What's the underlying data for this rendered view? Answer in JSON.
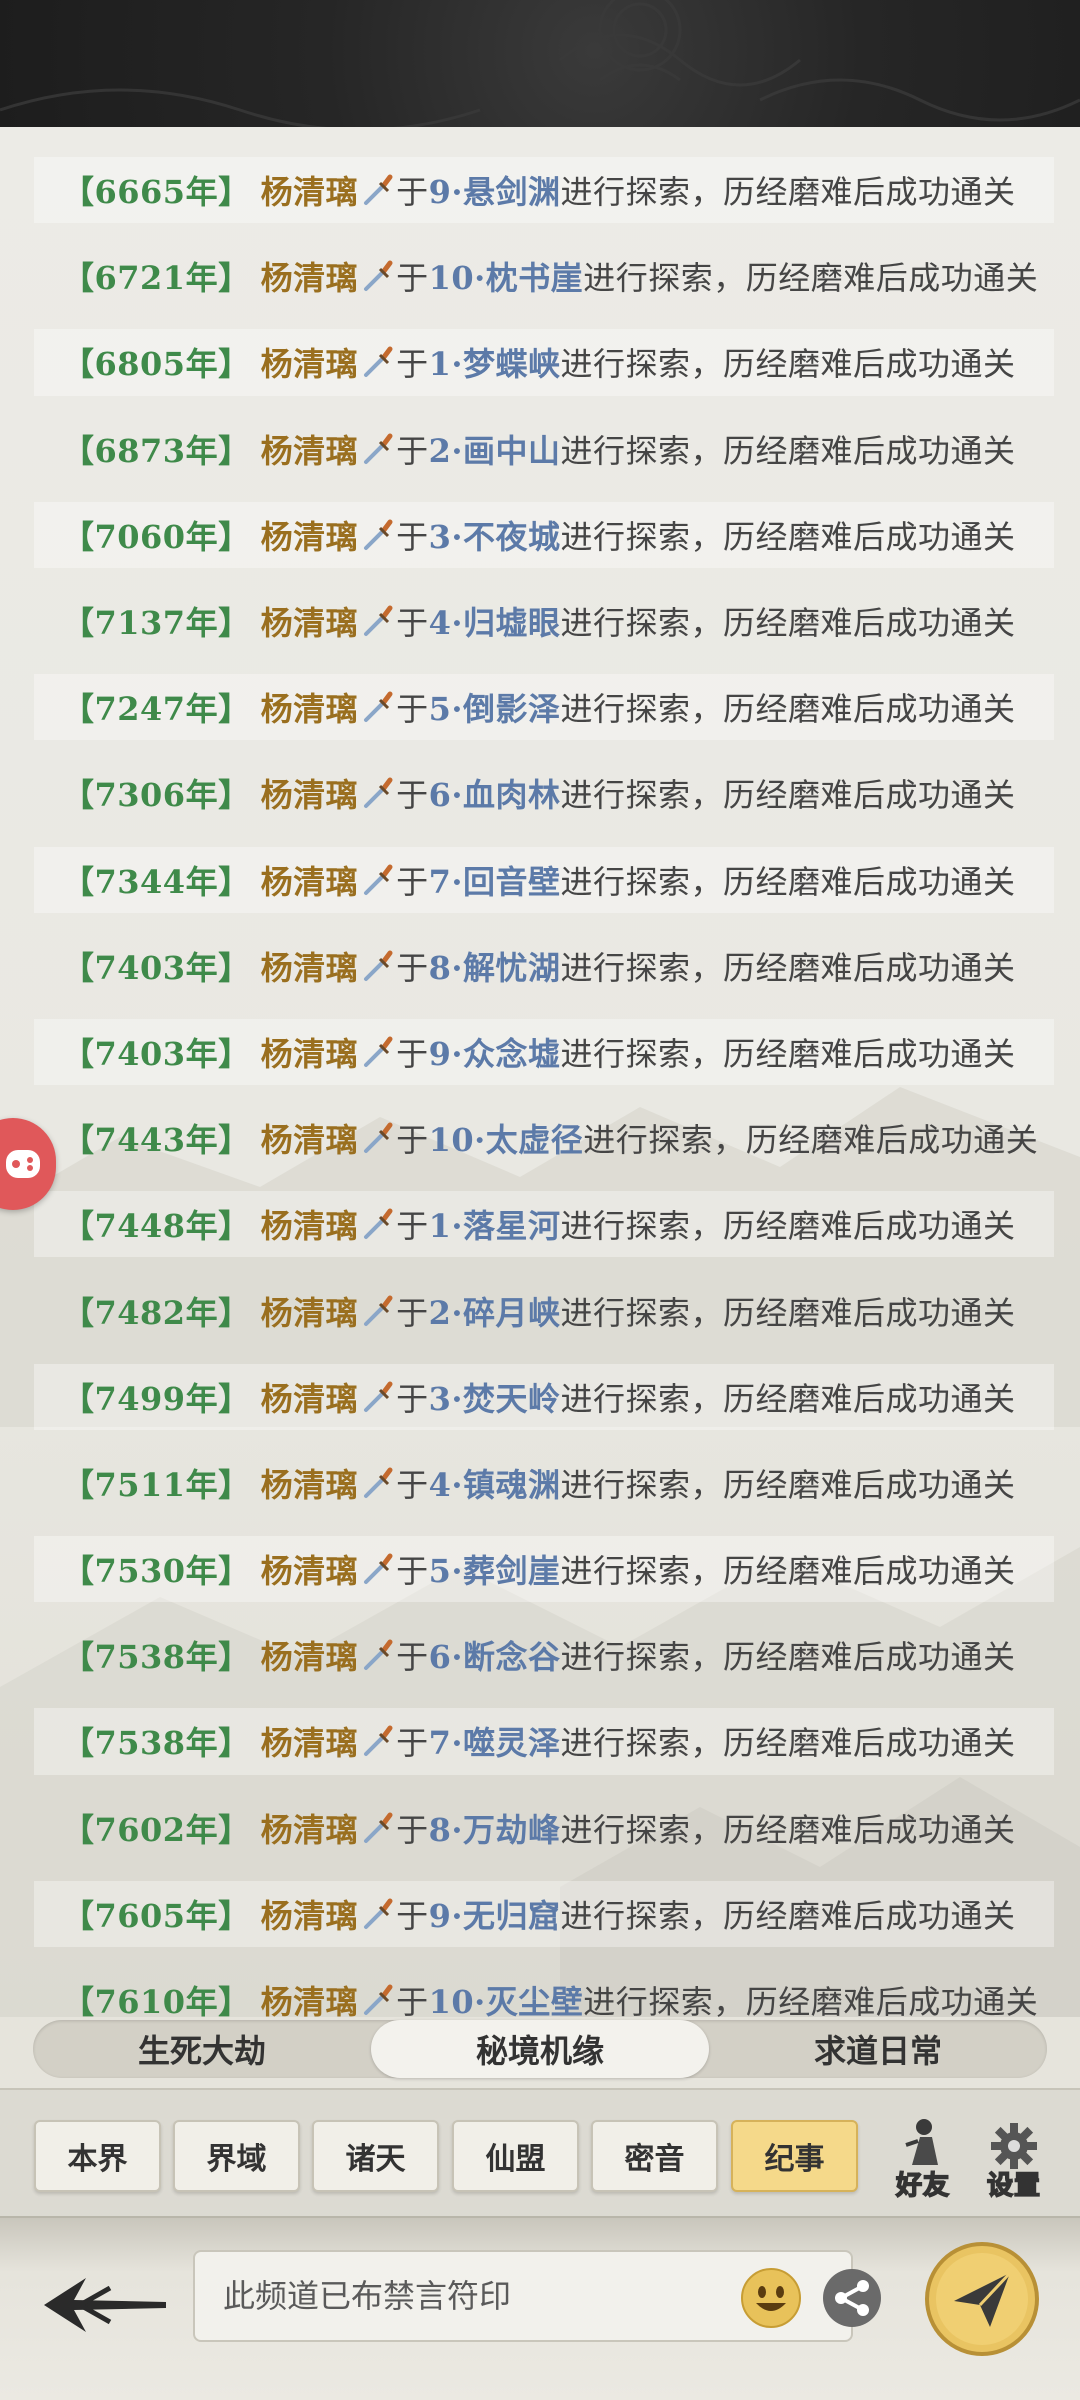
{
  "tabs": [
    {
      "label": "生死大劫",
      "active": false
    },
    {
      "label": "秘境机缘",
      "active": true
    },
    {
      "label": "求道日常",
      "active": false
    }
  ],
  "channels": [
    {
      "label": "本界",
      "active": false
    },
    {
      "label": "界域",
      "active": false
    },
    {
      "label": "诸天",
      "active": false
    },
    {
      "label": "仙盟",
      "active": false
    },
    {
      "label": "密音",
      "active": false
    },
    {
      "label": "纪事",
      "active": true
    }
  ],
  "friends_label": "好友",
  "settings_label": "设置",
  "input": {
    "placeholder": "此频道已布禁言符印"
  },
  "colors": {
    "year": "#3f8a4a",
    "name": "#9a6f1f",
    "place": "#5c7aa8",
    "text": "#454545",
    "active_channel": "#f5d98a"
  },
  "log_entries": [
    {
      "year": "【6665年】",
      "name": "杨清璃",
      "prefix": "于",
      "place": "9·悬剑渊",
      "text": "进行探索，历经磨难后成功通关"
    },
    {
      "year": "【6721年】",
      "name": "杨清璃",
      "prefix": "于",
      "place": "10·枕书崖",
      "text": "进行探索，历经磨难后成功通关"
    },
    {
      "year": "【6805年】",
      "name": "杨清璃",
      "prefix": "于",
      "place": "1·梦蝶峡",
      "text": "进行探索，历经磨难后成功通关"
    },
    {
      "year": "【6873年】",
      "name": "杨清璃",
      "prefix": "于",
      "place": "2·画中山",
      "text": "进行探索，历经磨难后成功通关"
    },
    {
      "year": "【7060年】",
      "name": "杨清璃",
      "prefix": "于",
      "place": "3·不夜城",
      "text": "进行探索，历经磨难后成功通关"
    },
    {
      "year": "【7137年】",
      "name": "杨清璃",
      "prefix": "于",
      "place": "4·归墟眼",
      "text": "进行探索，历经磨难后成功通关"
    },
    {
      "year": "【7247年】",
      "name": "杨清璃",
      "prefix": "于",
      "place": "5·倒影泽",
      "text": "进行探索，历经磨难后成功通关"
    },
    {
      "year": "【7306年】",
      "name": "杨清璃",
      "prefix": "于",
      "place": "6·血肉林",
      "text": "进行探索，历经磨难后成功通关"
    },
    {
      "year": "【7344年】",
      "name": "杨清璃",
      "prefix": "于",
      "place": "7·回音壁",
      "text": "进行探索，历经磨难后成功通关"
    },
    {
      "year": "【7403年】",
      "name": "杨清璃",
      "prefix": "于",
      "place": "8·解忧湖",
      "text": "进行探索，历经磨难后成功通关"
    },
    {
      "year": "【7403年】",
      "name": "杨清璃",
      "prefix": "于",
      "place": "9·众念墟",
      "text": "进行探索，历经磨难后成功通关"
    },
    {
      "year": "【7443年】",
      "name": "杨清璃",
      "prefix": "于",
      "place": "10·太虚径",
      "text": "进行探索，历经磨难后成功通关"
    },
    {
      "year": "【7448年】",
      "name": "杨清璃",
      "prefix": "于",
      "place": "1·落星河",
      "text": "进行探索，历经磨难后成功通关"
    },
    {
      "year": "【7482年】",
      "name": "杨清璃",
      "prefix": "于",
      "place": "2·碎月峡",
      "text": "进行探索，历经磨难后成功通关"
    },
    {
      "year": "【7499年】",
      "name": "杨清璃",
      "prefix": "于",
      "place": "3·焚天岭",
      "text": "进行探索，历经磨难后成功通关"
    },
    {
      "year": "【7511年】",
      "name": "杨清璃",
      "prefix": "于",
      "place": "4·镇魂渊",
      "text": "进行探索，历经磨难后成功通关"
    },
    {
      "year": "【7530年】",
      "name": "杨清璃",
      "prefix": "于",
      "place": "5·葬剑崖",
      "text": "进行探索，历经磨难后成功通关"
    },
    {
      "year": "【7538年】",
      "name": "杨清璃",
      "prefix": "于",
      "place": "6·断念谷",
      "text": "进行探索，历经磨难后成功通关"
    },
    {
      "year": "【7538年】",
      "name": "杨清璃",
      "prefix": "于",
      "place": "7·噬灵泽",
      "text": "进行探索，历经磨难后成功通关"
    },
    {
      "year": "【7602年】",
      "name": "杨清璃",
      "prefix": "于",
      "place": "8·万劫峰",
      "text": "进行探索，历经磨难后成功通关"
    },
    {
      "year": "【7605年】",
      "name": "杨清璃",
      "prefix": "于",
      "place": "9·无归窟",
      "text": "进行探索，历经磨难后成功通关"
    },
    {
      "year": "【7610年】",
      "name": "杨清璃",
      "prefix": "于",
      "place": "10·灭尘壁",
      "text": "进行探索，历经磨难后成功通关"
    }
  ]
}
